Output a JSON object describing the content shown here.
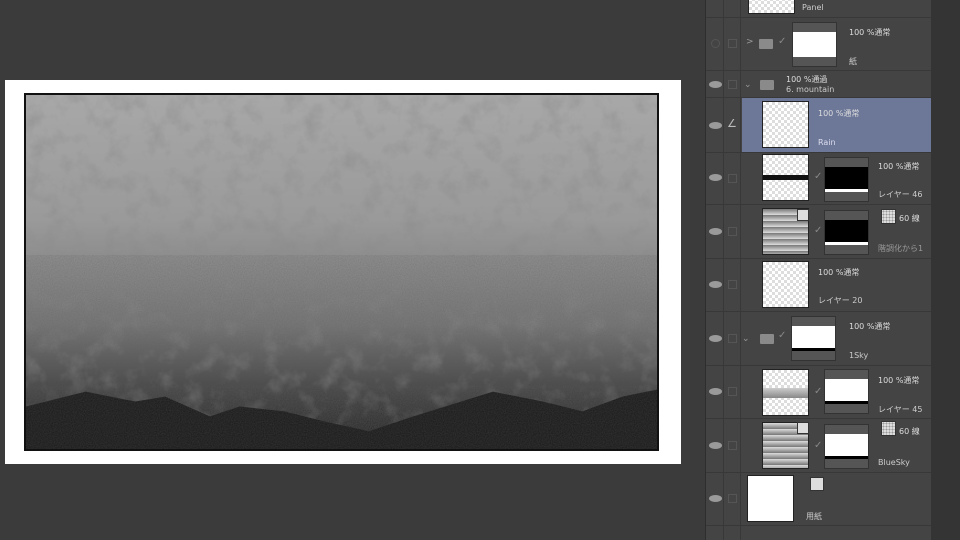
{
  "layers": [
    {
      "name": "Panel"
    },
    {
      "name": "紙",
      "mode": "100 %通常",
      "visible": false,
      "type": "folder",
      "expanded": false
    },
    {
      "name": "6. mountain",
      "mode": "100 %通過",
      "visible": true,
      "type": "folder",
      "expanded": true
    },
    {
      "name": "Rain",
      "mode": "100 %通常",
      "visible": true,
      "selected": true
    },
    {
      "name": "レイヤー 46",
      "mode": "100 %通常",
      "visible": true
    },
    {
      "name": "階調化から1",
      "mode": "60 線",
      "visible": true
    },
    {
      "name": "レイヤー 20",
      "mode": "100 %通常",
      "visible": true
    },
    {
      "name": "1Sky",
      "mode": "100 %通常",
      "visible": true,
      "type": "folder",
      "expanded": true
    },
    {
      "name": "レイヤー 45",
      "mode": "100 %通常",
      "visible": true
    },
    {
      "name": "BlueSky",
      "mode": "60 線",
      "visible": true
    },
    {
      "name": "用紙",
      "visible": true
    }
  ],
  "colors": {
    "selected": "#6d7899",
    "panel": "#444444",
    "canvas_bg": "#3b3b3b"
  }
}
